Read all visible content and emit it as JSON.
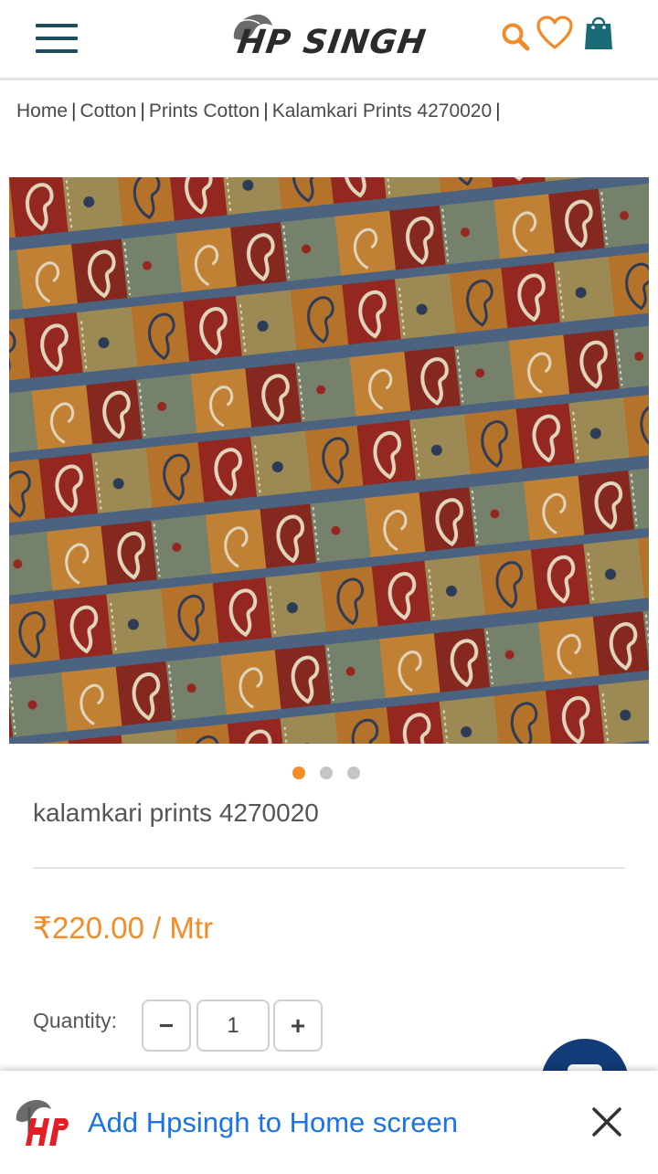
{
  "header": {
    "logo_text": "HP SINGH",
    "icons": [
      "menu-icon",
      "search-icon",
      "heart-icon",
      "shopping-bag-icon"
    ],
    "colors": {
      "brand_teal": "#1d4f5c",
      "accent_orange": "#f28c28"
    }
  },
  "breadcrumb": {
    "items": [
      "Home",
      "Cotton",
      "Prints Cotton",
      "Kalamkari Prints 4270020"
    ],
    "separator": "|"
  },
  "product": {
    "image_alt": "kalamkari prints fabric",
    "carousel": {
      "count": 3,
      "active": 1
    },
    "title": "kalamkari prints 4270020",
    "price": "₹220.00 / Mtr",
    "quantity_label": "Quantity:",
    "quantity_value": "1",
    "minus_label": "−",
    "plus_label": "+"
  },
  "chat": {
    "icon": "chat-icon",
    "color": "#123c78"
  },
  "add_to_home": {
    "text": "Add Hpsingh to Home screen",
    "close_icon": "close-icon",
    "link_color": "#1a73e8"
  }
}
